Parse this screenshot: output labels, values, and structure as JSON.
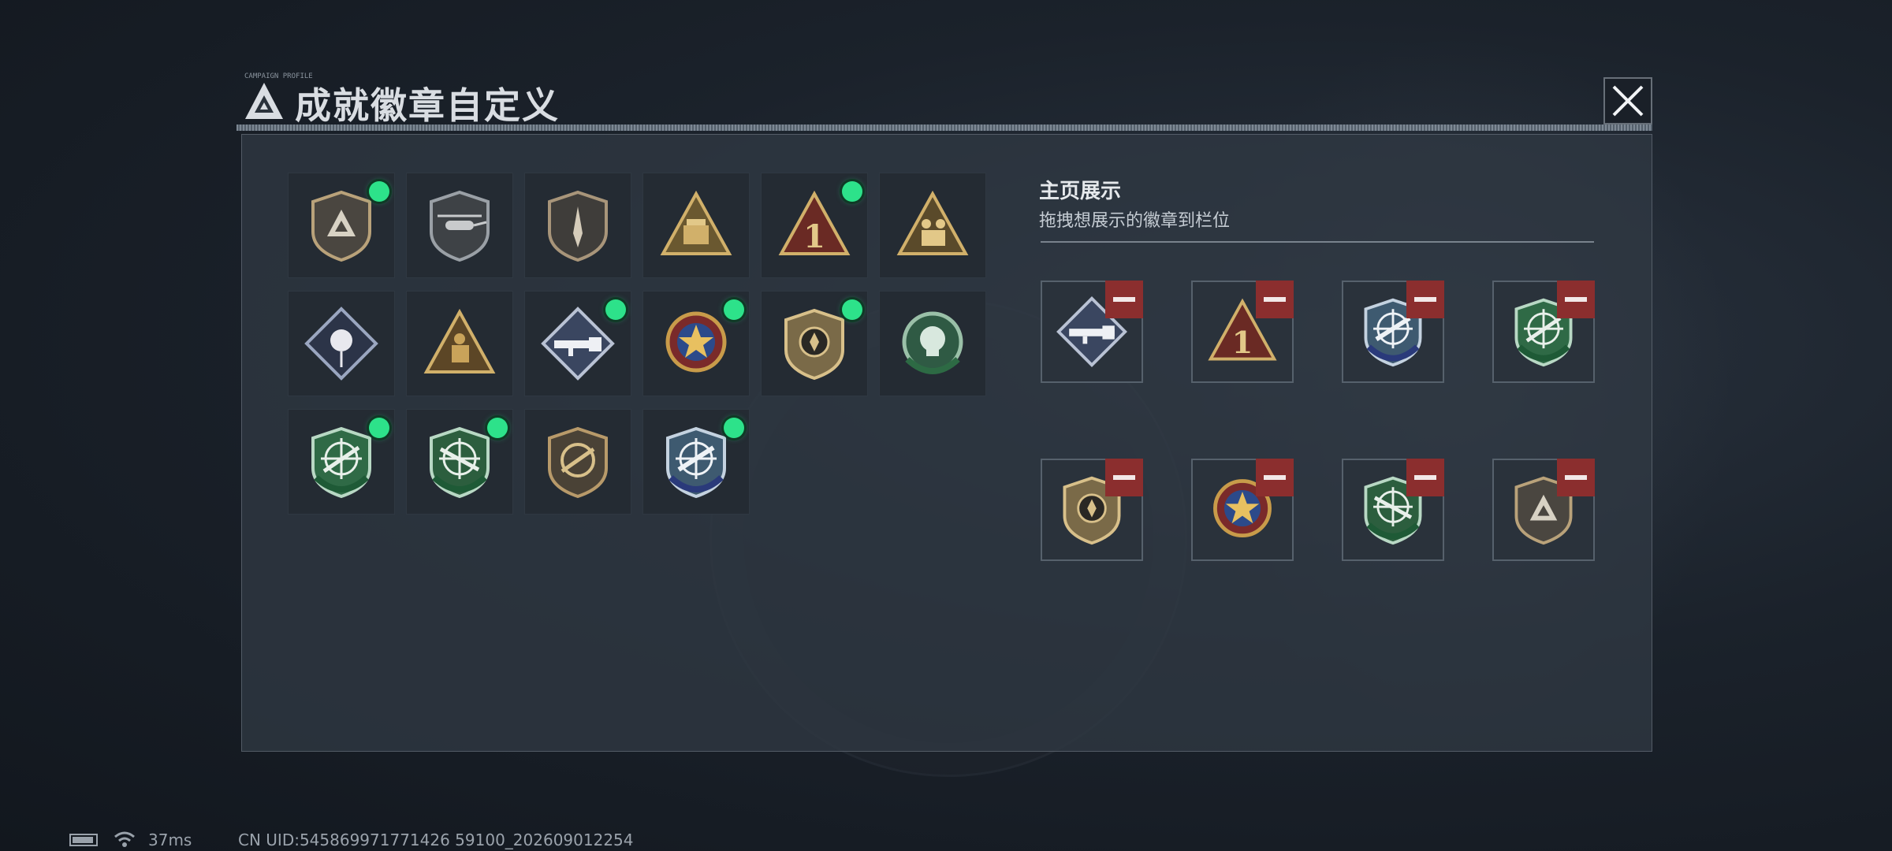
{
  "window": {
    "title": "成就徽章自定义",
    "title_small": "CAMPAIGN PROFILE",
    "close_icon": "close-icon"
  },
  "badge_grid": [
    {
      "icon": "triangle-shield-badge",
      "owned": true
    },
    {
      "icon": "helicopter-shield-badge",
      "owned": false
    },
    {
      "icon": "dagger-shield-badge",
      "owned": false
    },
    {
      "icon": "missile-launcher-triangle-badge",
      "owned": false
    },
    {
      "icon": "number-one-triangle-badge",
      "owned": true
    },
    {
      "icon": "soldiers-triangle-badge",
      "owned": false
    },
    {
      "icon": "rose-diamond-badge",
      "owned": false
    },
    {
      "icon": "soldier-kneeling-triangle-badge",
      "owned": false
    },
    {
      "icon": "rocket-launcher-diamond-badge",
      "owned": true
    },
    {
      "icon": "star-medal-badge",
      "owned": true
    },
    {
      "icon": "gold-emblem-shield-badge",
      "owned": true
    },
    {
      "icon": "green-skull-badge",
      "owned": false
    },
    {
      "icon": "green-rifle-crosshair-badge",
      "owned": true
    },
    {
      "icon": "green-sniper-crosshair-badge",
      "owned": true
    },
    {
      "icon": "bronze-rifle-circle-badge",
      "owned": false
    },
    {
      "icon": "blue-rocket-crosshair-badge",
      "owned": true
    }
  ],
  "showcase": {
    "title": "主页展示",
    "subtitle": "拖拽想展示的徽章到栏位",
    "slots": [
      {
        "icon": "rocket-launcher-diamond-badge"
      },
      {
        "icon": "number-one-triangle-badge"
      },
      {
        "icon": "blue-rocket-crosshair-badge"
      },
      {
        "icon": "green-rifle-crosshair-badge"
      },
      {
        "icon": "gold-emblem-shield-badge"
      },
      {
        "icon": "star-medal-badge"
      },
      {
        "icon": "green-sniper-crosshair-badge"
      },
      {
        "icon": "triangle-shield-badge"
      }
    ],
    "remove_icon": "minus-icon",
    "accent_remove": "#8b2e2e",
    "accent_owned": "#2de28a"
  },
  "status_bar": {
    "battery_icon": "battery-icon",
    "wifi_icon": "wifi-icon",
    "ping": "37ms",
    "uid": "CN UID:545869971771426 59100_202609012254"
  }
}
